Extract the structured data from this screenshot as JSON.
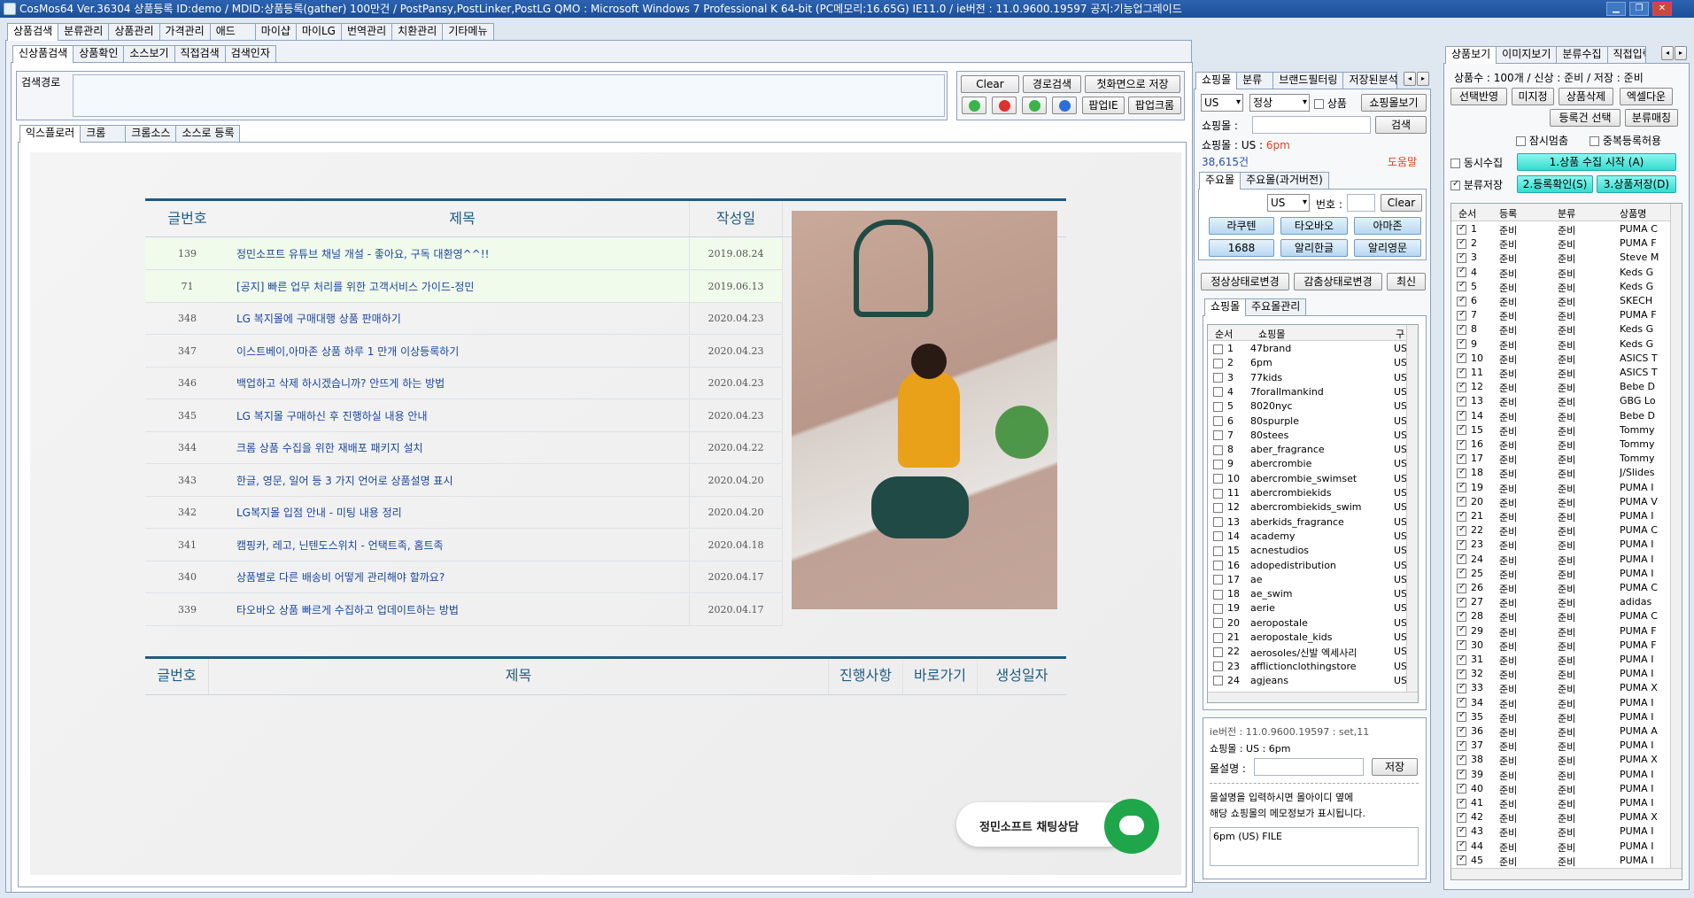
{
  "window": {
    "title": "CosMos64 Ver.36304 상품등록 ID:demo / MDID:상품등록(gather) 100만건 / PostPansy,PostLinker,PostLG QMO : Microsoft Windows 7 Professional K 64-bit (PC메모리:16.65G) IE11.0 / ie버전 : 11.0.9600.19597 공지:기능업그레이드"
  },
  "main_tabs": [
    "상품검색",
    "분류관리",
    "상품관리",
    "가격관리",
    "애드",
    "마이샵",
    "마이LG",
    "번역관리",
    "치환관리",
    "기타메뉴"
  ],
  "sub_tabs": [
    "신상품검색",
    "상품확인",
    "소스보기",
    "직접검색",
    "검색인자"
  ],
  "search": {
    "label": "검색경로",
    "value": ""
  },
  "search_buttons": {
    "clear": "Clear",
    "route_search": "경로검색",
    "save_first": "첫화면으로 저장",
    "popup_ie": "팝업IE",
    "popup_chrome": "팝업크롬"
  },
  "browser_tabs": [
    "익스플로러",
    "크롬",
    "크롬소스",
    "소스로 등록"
  ],
  "board": {
    "headers": {
      "no": "글번호",
      "title": "제목",
      "date": "작성일"
    },
    "rows": [
      {
        "no": "139",
        "title": "정민소프트 유튜브 채널 개설 - 좋아요, 구독 대환영^^!!",
        "date": "2019.08.24"
      },
      {
        "no": "71",
        "title": "[공지] 빠른 업무 처리를 위한 고객서비스 가이드-정민",
        "date": "2019.06.13"
      },
      {
        "no": "348",
        "title": "LG 복지몰에 구매대행 상품 판매하기",
        "date": "2020.04.23"
      },
      {
        "no": "347",
        "title": "이스트베이,아마존 상품 하루 1 만개 이상등록하기",
        "date": "2020.04.23"
      },
      {
        "no": "346",
        "title": "백업하고 삭제 하시겠습니까? 안뜨게 하는 방법",
        "date": "2020.04.23"
      },
      {
        "no": "345",
        "title": "LG 복지몰 구매하신 후 진행하실 내용 안내",
        "date": "2020.04.23"
      },
      {
        "no": "344",
        "title": "크롬 상품 수집을 위한 재배포 패키지 설치",
        "date": "2020.04.22"
      },
      {
        "no": "343",
        "title": "한글, 영문, 일어 등 3 가지 언어로 상품설명 표시",
        "date": "2020.04.20"
      },
      {
        "no": "342",
        "title": "LG복지몰 입점 안내 - 미팅 내용 정리",
        "date": "2020.04.20"
      },
      {
        "no": "341",
        "title": "캠핑카, 레고, 닌텐도스위치 - 언택트족, 홈트족",
        "date": "2020.04.18"
      },
      {
        "no": "340",
        "title": "상품별로 다른 배송비 어떻게 관리해야 할까요?",
        "date": "2020.04.17"
      },
      {
        "no": "339",
        "title": "타오바오 상품 빠르게 수집하고 업데이트하는 방법",
        "date": "2020.04.17"
      }
    ],
    "headers2": {
      "no": "글번호",
      "title": "제목",
      "status": "진행사항",
      "goto": "바로가기",
      "created": "생성일자"
    }
  },
  "chat": {
    "label": "정민소프트 채팅상담"
  },
  "shop_tabs": [
    "쇼핑몰",
    "분류",
    "브랜드필터링",
    "저장된분석"
  ],
  "shop": {
    "country": "US",
    "status": "정상",
    "product_check": "상품",
    "view_btn": "쇼핑몰보기",
    "shop_label": "쇼핑몰 :",
    "search_btn": "검색",
    "current_label": "쇼핑몰 :",
    "current_country": "US",
    "current_sep": ":",
    "current_shop": "6pm",
    "count": "38,615건",
    "help": "도움말"
  },
  "major_tabs": [
    "주요몰",
    "주요몰(과거버전)"
  ],
  "major": {
    "country": "US",
    "num_label": "번호 :",
    "clear": "Clear",
    "buttons": [
      "라쿠텐",
      "타오바오",
      "아마존",
      "1688",
      "알리한글",
      "알리영문"
    ]
  },
  "status_buttons": [
    "정상상태로변경",
    "감춤상태로변경",
    "최신"
  ],
  "mall_tabs": [
    "쇼핑몰",
    "주요몰관리"
  ],
  "mall_list": {
    "headers": [
      "순서",
      "쇼핑몰",
      "구"
    ],
    "rows": [
      [
        "1",
        "47brand"
      ],
      [
        "2",
        "6pm"
      ],
      [
        "3",
        "77kids"
      ],
      [
        "4",
        "7forallmankind"
      ],
      [
        "5",
        "8020nyc"
      ],
      [
        "6",
        "80spurple"
      ],
      [
        "7",
        "80stees"
      ],
      [
        "8",
        "aber_fragrance"
      ],
      [
        "9",
        "abercrombie"
      ],
      [
        "10",
        "abercrombie_swimset"
      ],
      [
        "11",
        "abercrombiekids"
      ],
      [
        "12",
        "abercrombiekids_swim"
      ],
      [
        "13",
        "aberkids_fragrance"
      ],
      [
        "14",
        "academy"
      ],
      [
        "15",
        "acnestudios"
      ],
      [
        "16",
        "adopedistribution"
      ],
      [
        "17",
        "ae"
      ],
      [
        "18",
        "ae_swim"
      ],
      [
        "19",
        "aerie"
      ],
      [
        "20",
        "aeropostale"
      ],
      [
        "21",
        "aeropostale_kids"
      ],
      [
        "22",
        "aerosoles/신발 엑세사리"
      ],
      [
        "23",
        "afflictionclothingstore"
      ],
      [
        "24",
        "agjeans"
      ]
    ],
    "country_col": "US"
  },
  "info": {
    "ie_version": "ie버전 :  11.0.9600.19597 : set,11",
    "shop_line": "쇼핑몰 :  US     :  6pm",
    "desc_label": "몰설명 :",
    "save": "저장",
    "note1": "몰설명을 입력하시면 몰아이디 옆에",
    "note2": "해당 쇼핑몰의 메모정보가 표시됩니다.",
    "memo": "6pm (US) FILE"
  },
  "right_tabs": [
    "상품보기",
    "이미지보기",
    "분류수집",
    "직접입력"
  ],
  "right": {
    "summary": "상품수 : 100개 / 신상 : 준비 / 저장 : 준비",
    "btn_select_apply": "선택반영",
    "btn_no_image": "미지정",
    "btn_delete": "상품삭제",
    "btn_excel": "엑셀다운",
    "btn_registered": "등록건 선택",
    "btn_category": "분류매칭",
    "chk_pause": "잠시멈춤",
    "chk_dup": "중복등록허용",
    "chk_concurrent": "동시수집",
    "btn_start": "1.상품 수집 시작 (A)",
    "chk_category_save": "분류저장",
    "btn_confirm": "2.등록확인(S)",
    "btn_save": "3.상품저장(D)"
  },
  "product_list": {
    "headers": [
      "순서",
      "등록",
      "분류",
      "상품명"
    ],
    "rows": [
      [
        "1",
        "준비",
        "준비",
        "PUMA C"
      ],
      [
        "2",
        "준비",
        "준비",
        "PUMA F"
      ],
      [
        "3",
        "준비",
        "준비",
        "Steve M"
      ],
      [
        "4",
        "준비",
        "준비",
        "Keds G"
      ],
      [
        "5",
        "준비",
        "준비",
        "Keds G"
      ],
      [
        "6",
        "준비",
        "준비",
        "SKECH"
      ],
      [
        "7",
        "준비",
        "준비",
        "PUMA F"
      ],
      [
        "8",
        "준비",
        "준비",
        "Keds G"
      ],
      [
        "9",
        "준비",
        "준비",
        "Keds G"
      ],
      [
        "10",
        "준비",
        "준비",
        "ASICS T"
      ],
      [
        "11",
        "준비",
        "준비",
        "ASICS T"
      ],
      [
        "12",
        "준비",
        "준비",
        "Bebe D"
      ],
      [
        "13",
        "준비",
        "준비",
        "GBG Lo"
      ],
      [
        "14",
        "준비",
        "준비",
        "Bebe D"
      ],
      [
        "15",
        "준비",
        "준비",
        "Tommy"
      ],
      [
        "16",
        "준비",
        "준비",
        "Tommy"
      ],
      [
        "17",
        "준비",
        "준비",
        "Tommy"
      ],
      [
        "18",
        "준비",
        "준비",
        "J/Slides"
      ],
      [
        "19",
        "준비",
        "준비",
        "PUMA I"
      ],
      [
        "20",
        "준비",
        "준비",
        "PUMA V"
      ],
      [
        "21",
        "준비",
        "준비",
        "PUMA I"
      ],
      [
        "22",
        "준비",
        "준비",
        "PUMA C"
      ],
      [
        "23",
        "준비",
        "준비",
        "PUMA I"
      ],
      [
        "24",
        "준비",
        "준비",
        "PUMA I"
      ],
      [
        "25",
        "준비",
        "준비",
        "PUMA I"
      ],
      [
        "26",
        "준비",
        "준비",
        "PUMA C"
      ],
      [
        "27",
        "준비",
        "준비",
        "adidas"
      ],
      [
        "28",
        "준비",
        "준비",
        "PUMA C"
      ],
      [
        "29",
        "준비",
        "준비",
        "PUMA F"
      ],
      [
        "30",
        "준비",
        "준비",
        "PUMA F"
      ],
      [
        "31",
        "준비",
        "준비",
        "PUMA I"
      ],
      [
        "32",
        "준비",
        "준비",
        "PUMA I"
      ],
      [
        "33",
        "준비",
        "준비",
        "PUMA X"
      ],
      [
        "34",
        "준비",
        "준비",
        "PUMA I"
      ],
      [
        "35",
        "준비",
        "준비",
        "PUMA I"
      ],
      [
        "36",
        "준비",
        "준비",
        "PUMA A"
      ],
      [
        "37",
        "준비",
        "준비",
        "PUMA I"
      ],
      [
        "38",
        "준비",
        "준비",
        "PUMA X"
      ],
      [
        "39",
        "준비",
        "준비",
        "PUMA I"
      ],
      [
        "40",
        "준비",
        "준비",
        "PUMA I"
      ],
      [
        "41",
        "준비",
        "준비",
        "PUMA I"
      ],
      [
        "42",
        "준비",
        "준비",
        "PUMA X"
      ],
      [
        "43",
        "준비",
        "준비",
        "PUMA I"
      ],
      [
        "44",
        "준비",
        "준비",
        "PUMA I"
      ],
      [
        "45",
        "준비",
        "준비",
        "PUMA I"
      ]
    ]
  },
  "colors": {
    "title_bar": "#1d4f97",
    "accent_cyan": "#35dccf",
    "chat_green": "#1fa64a",
    "link_blue": "#1b46a0",
    "shop_red": "#e0401a"
  }
}
